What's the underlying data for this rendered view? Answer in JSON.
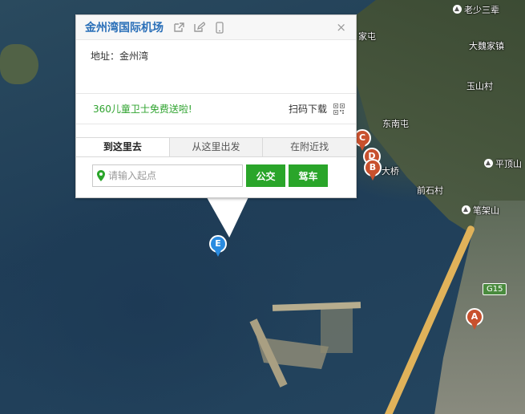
{
  "popup": {
    "title": "金州湾国际机场",
    "address_label": "地址：金州湾",
    "promo_text": "360儿童卫士免费送啦!",
    "qr_label": "扫码下载",
    "close_glyph": "×",
    "tabs": [
      "到这里去",
      "从这里出发",
      "在附近找"
    ],
    "active_tab": 0,
    "start_placeholder": "请输入起点",
    "bus_button": "公交",
    "drive_button": "驾车"
  },
  "map": {
    "labels": [
      {
        "text": "老少三辈",
        "poi": true
      },
      {
        "text": "大魏家镇",
        "poi": false
      },
      {
        "text": "玉山村",
        "poi": false
      },
      {
        "text": "家屯",
        "poi": false
      },
      {
        "text": "东南屯",
        "poi": false
      },
      {
        "text": "平顶山",
        "poi": true
      },
      {
        "text": "前石村",
        "poi": false
      },
      {
        "text": "笔架山",
        "poi": true
      },
      {
        "text": "大桥",
        "poi": false
      }
    ],
    "highway_shield": "G15",
    "markers": [
      "A",
      "B",
      "C",
      "D",
      "E"
    ]
  },
  "colors": {
    "title_blue": "#2a6fb8",
    "green": "#2aa52a",
    "promo_green": "#2fa32f",
    "marker_red": "#c8512e",
    "marker_blue": "#2a8be0"
  },
  "icons": [
    "share-icon",
    "edit-icon",
    "phone-icon",
    "close-icon",
    "qr-code-icon",
    "location-pin-icon"
  ]
}
